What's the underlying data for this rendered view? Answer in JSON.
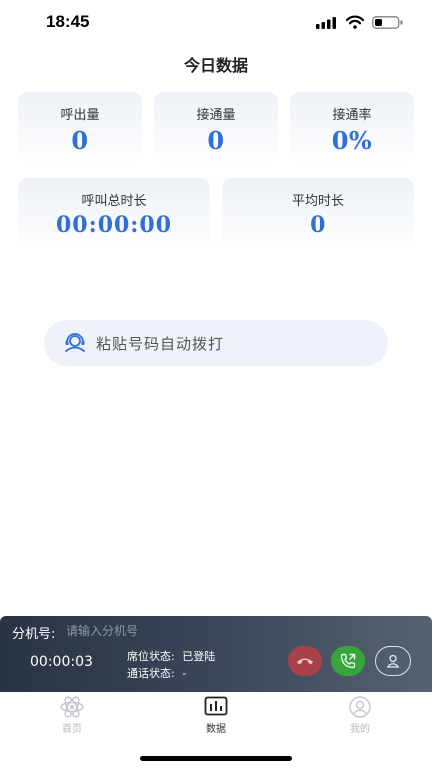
{
  "status_bar": {
    "time": "18:45"
  },
  "page": {
    "title": "今日数据"
  },
  "stats": {
    "calls_out": {
      "label": "呼出量",
      "value": "0"
    },
    "connected": {
      "label": "接通量",
      "value": "0"
    },
    "connect_rate": {
      "label": "接通率",
      "value": "0%"
    },
    "total_duration": {
      "label": "呼叫总时长",
      "value": "00:00:00"
    },
    "avg_duration": {
      "label": "平均时长",
      "value": "0"
    }
  },
  "paste_dial": {
    "label": "粘贴号码自动拨打",
    "icon": "headset-icon"
  },
  "call_bar": {
    "extension_label": "分机号:",
    "extension_placeholder": "请输入分机号",
    "extension_value": "",
    "timer": "00:00:03",
    "seat_status_label": "席位状态:",
    "seat_status_value": "已登陆",
    "call_status_label": "通话状态:",
    "call_status_value": "-"
  },
  "tabs": [
    {
      "label": "首页",
      "icon": "atom-icon",
      "active": false
    },
    {
      "label": "数据",
      "icon": "chart-icon",
      "active": true
    },
    {
      "label": "我的",
      "icon": "user-icon",
      "active": false
    }
  ],
  "colors": {
    "accent_blue": "#2f6fd6",
    "hangup_red": "#a84148",
    "answer_green": "#36a53b",
    "call_bar_dark": "#2a3344"
  }
}
